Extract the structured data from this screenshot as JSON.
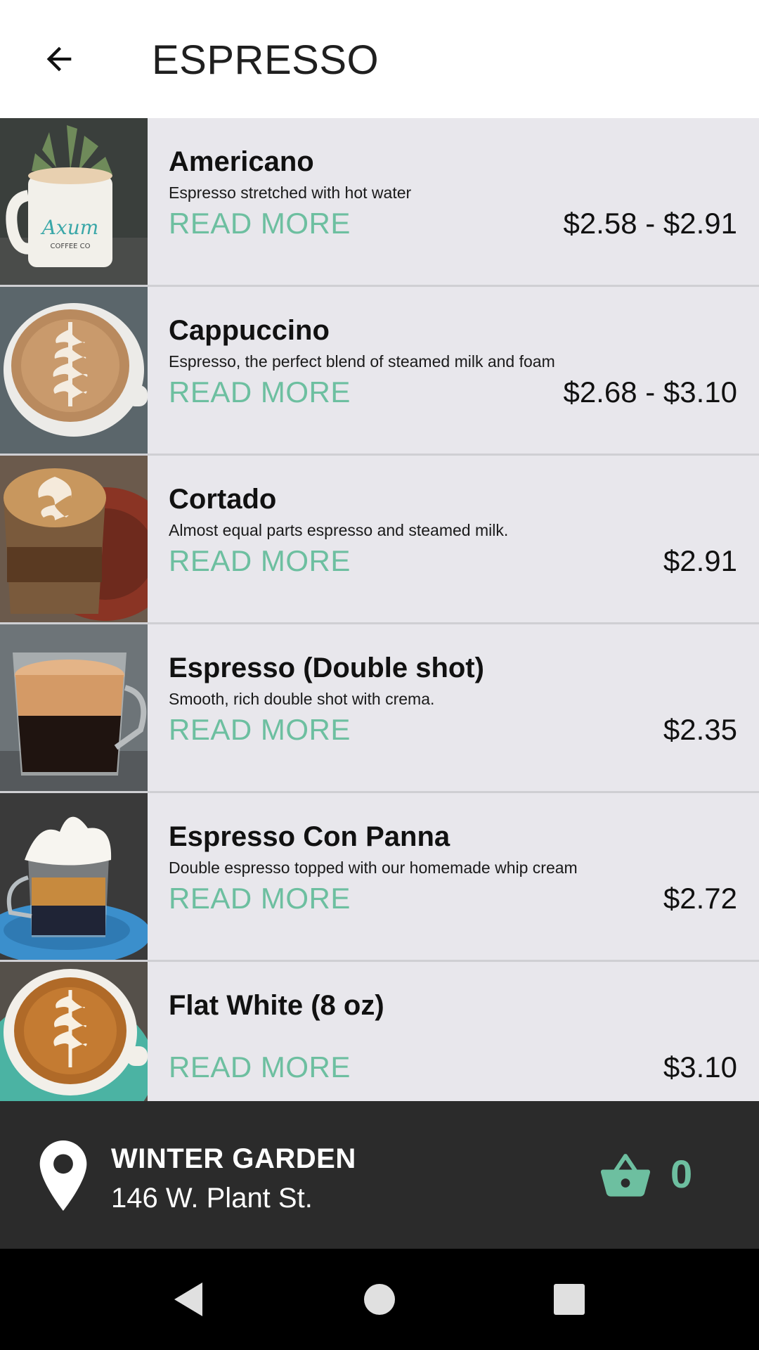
{
  "header": {
    "title": "ESPRESSO",
    "back_icon": "arrow-left-icon"
  },
  "items": [
    {
      "name": "Americano",
      "description": "Espresso stretched with hot water",
      "read_more": "READ MORE",
      "price": "$2.58 - $2.91",
      "image": "americano-mug-photo"
    },
    {
      "name": "Cappuccino",
      "description": "Espresso, the perfect blend of steamed milk and foam",
      "read_more": "READ MORE",
      "price": "$2.68 - $3.10",
      "image": "cappuccino-cup-photo"
    },
    {
      "name": "Cortado",
      "description": "Almost equal parts espresso and steamed milk.",
      "read_more": "READ MORE",
      "price": "$2.91",
      "image": "cortado-glass-photo"
    },
    {
      "name": "Espresso (Double shot)",
      "description": "Smooth, rich double shot with crema.",
      "read_more": "READ MORE",
      "price": "$2.35",
      "image": "espresso-glass-photo"
    },
    {
      "name": "Espresso Con Panna",
      "description": "Double espresso topped with our homemade whip cream",
      "read_more": "READ MORE",
      "price": "$2.72",
      "image": "con-panna-glass-photo"
    },
    {
      "name": "Flat White (8 oz)",
      "description": "",
      "read_more": "READ MORE",
      "price": "$3.10",
      "image": "flat-white-cup-photo"
    }
  ],
  "store": {
    "name": "WINTER GARDEN",
    "address": "146 W. Plant St.",
    "pin_icon": "location-pin-icon",
    "cart_icon": "shopping-basket-icon",
    "cart_count": "0"
  },
  "nav": {
    "back": "nav-back-icon",
    "home": "nav-home-icon",
    "recents": "nav-recents-icon"
  },
  "colors": {
    "accent": "#6dbfa0",
    "list_background": "#e8e7ec",
    "store_bar": "#2b2b2b",
    "nav_bar": "#000000"
  }
}
